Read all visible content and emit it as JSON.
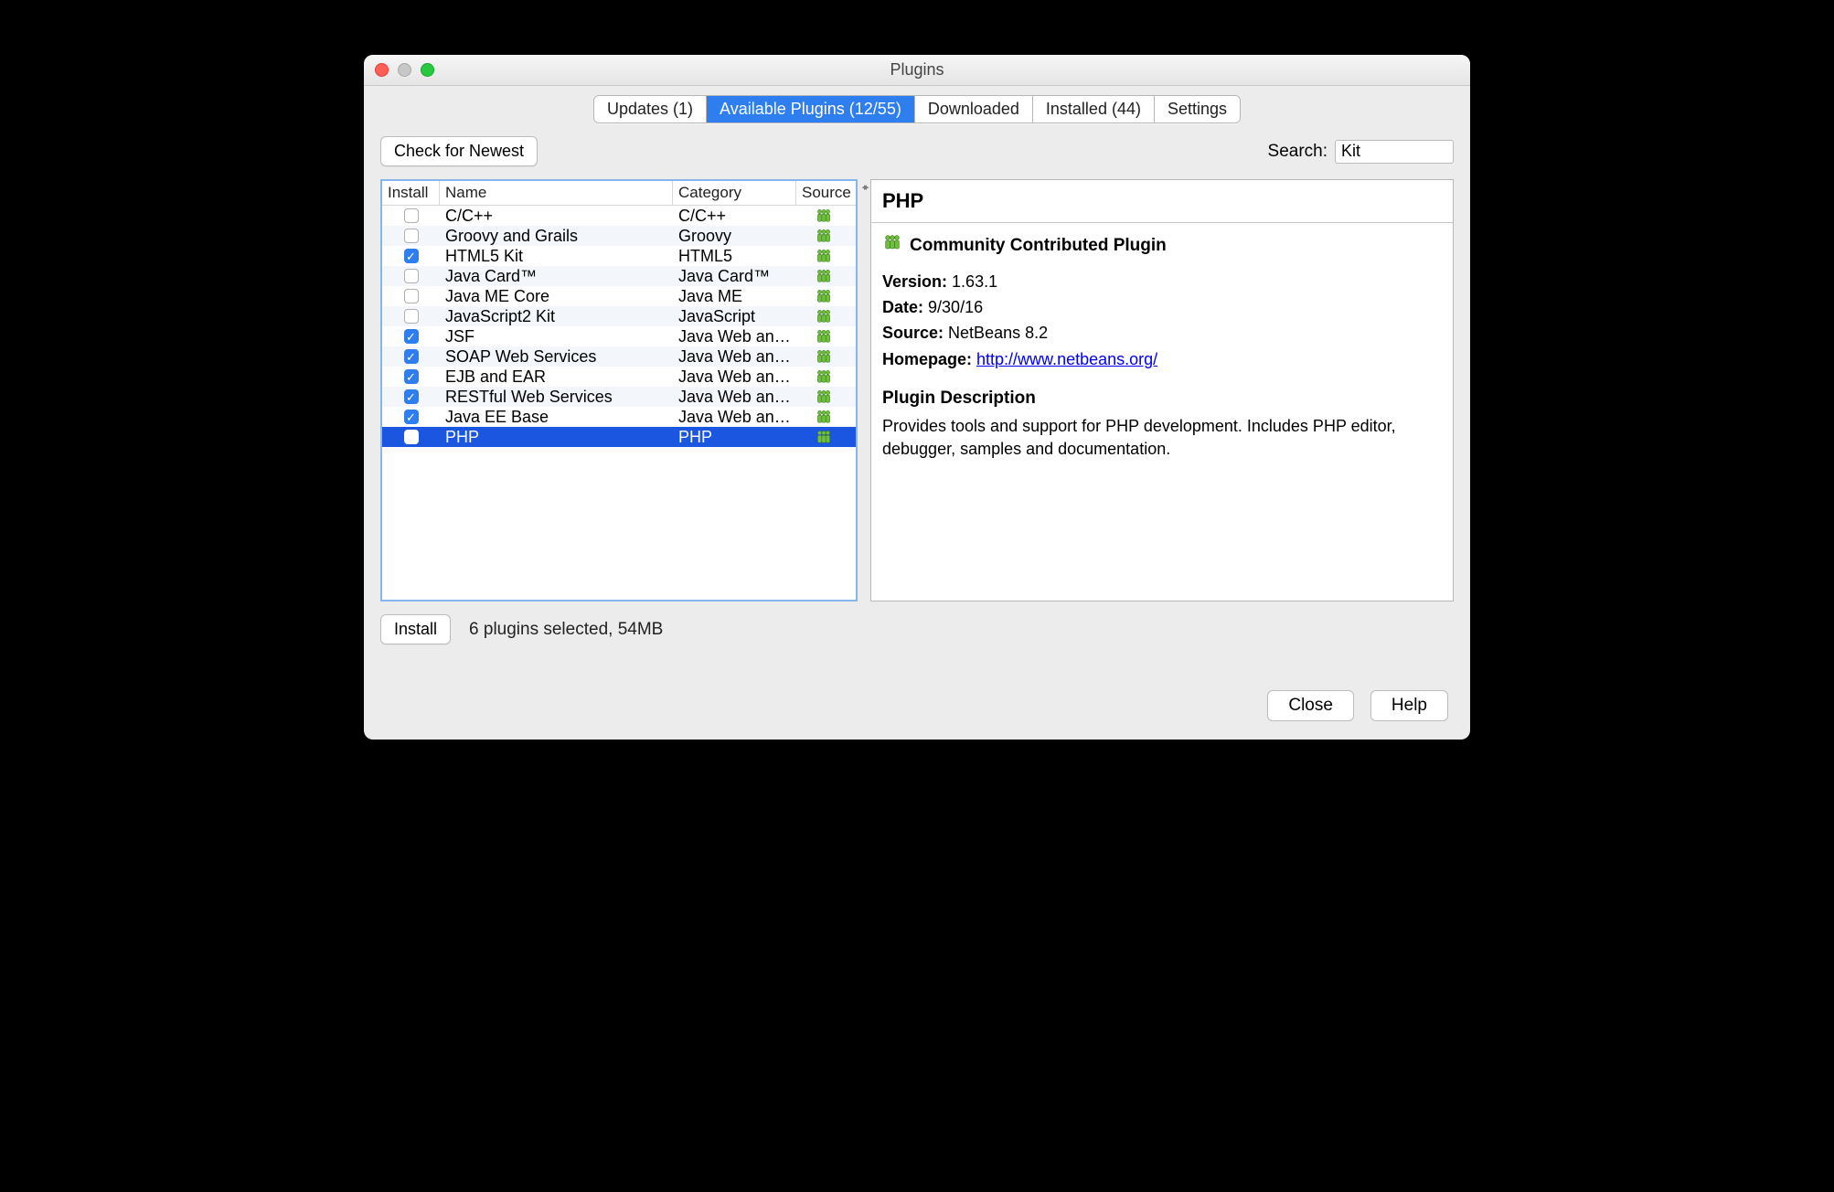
{
  "window": {
    "title": "Plugins"
  },
  "tabs": {
    "updates": "Updates (1)",
    "available": "Available Plugins (12/55)",
    "downloaded": "Downloaded",
    "installed": "Installed (44)",
    "settings": "Settings"
  },
  "actions": {
    "check_newest": "Check for Newest",
    "search_label": "Search:",
    "search_value": "Kit",
    "install": "Install",
    "close": "Close",
    "help": "Help"
  },
  "table": {
    "headers": {
      "install": "Install",
      "name": "Name",
      "category": "Category",
      "source": "Source"
    },
    "rows": [
      {
        "checked": false,
        "name": "C/C++",
        "category": "C/C++",
        "selected": false
      },
      {
        "checked": false,
        "name": "Groovy and Grails",
        "category": "Groovy",
        "selected": false
      },
      {
        "checked": true,
        "name": "HTML5 Kit",
        "category": "HTML5",
        "selected": false
      },
      {
        "checked": false,
        "name": "Java Card™",
        "category": "Java Card™",
        "selected": false
      },
      {
        "checked": false,
        "name": "Java ME Core",
        "category": "Java ME",
        "selected": false
      },
      {
        "checked": false,
        "name": "JavaScript2 Kit",
        "category": "JavaScript",
        "selected": false
      },
      {
        "checked": true,
        "name": "JSF",
        "category": "Java Web and …",
        "selected": false
      },
      {
        "checked": true,
        "name": "SOAP Web Services",
        "category": "Java Web and …",
        "selected": false
      },
      {
        "checked": true,
        "name": "EJB and EAR",
        "category": "Java Web and …",
        "selected": false
      },
      {
        "checked": true,
        "name": "RESTful Web Services",
        "category": "Java Web and …",
        "selected": false
      },
      {
        "checked": true,
        "name": "Java EE Base",
        "category": "Java Web and …",
        "selected": false
      },
      {
        "checked": false,
        "name": "PHP",
        "category": "PHP",
        "selected": true
      }
    ]
  },
  "status": "6 plugins selected, 54MB",
  "detail": {
    "title": "PHP",
    "community_label": "Community Contributed Plugin",
    "version_label": "Version:",
    "version": "1.63.1",
    "date_label": "Date:",
    "date": "9/30/16",
    "source_label": "Source:",
    "source": "NetBeans 8.2",
    "homepage_label": "Homepage:",
    "homepage": "http://www.netbeans.org/",
    "description_heading": "Plugin Description",
    "description": "Provides tools and support for PHP development. Includes PHP editor, debugger, samples and documentation."
  }
}
